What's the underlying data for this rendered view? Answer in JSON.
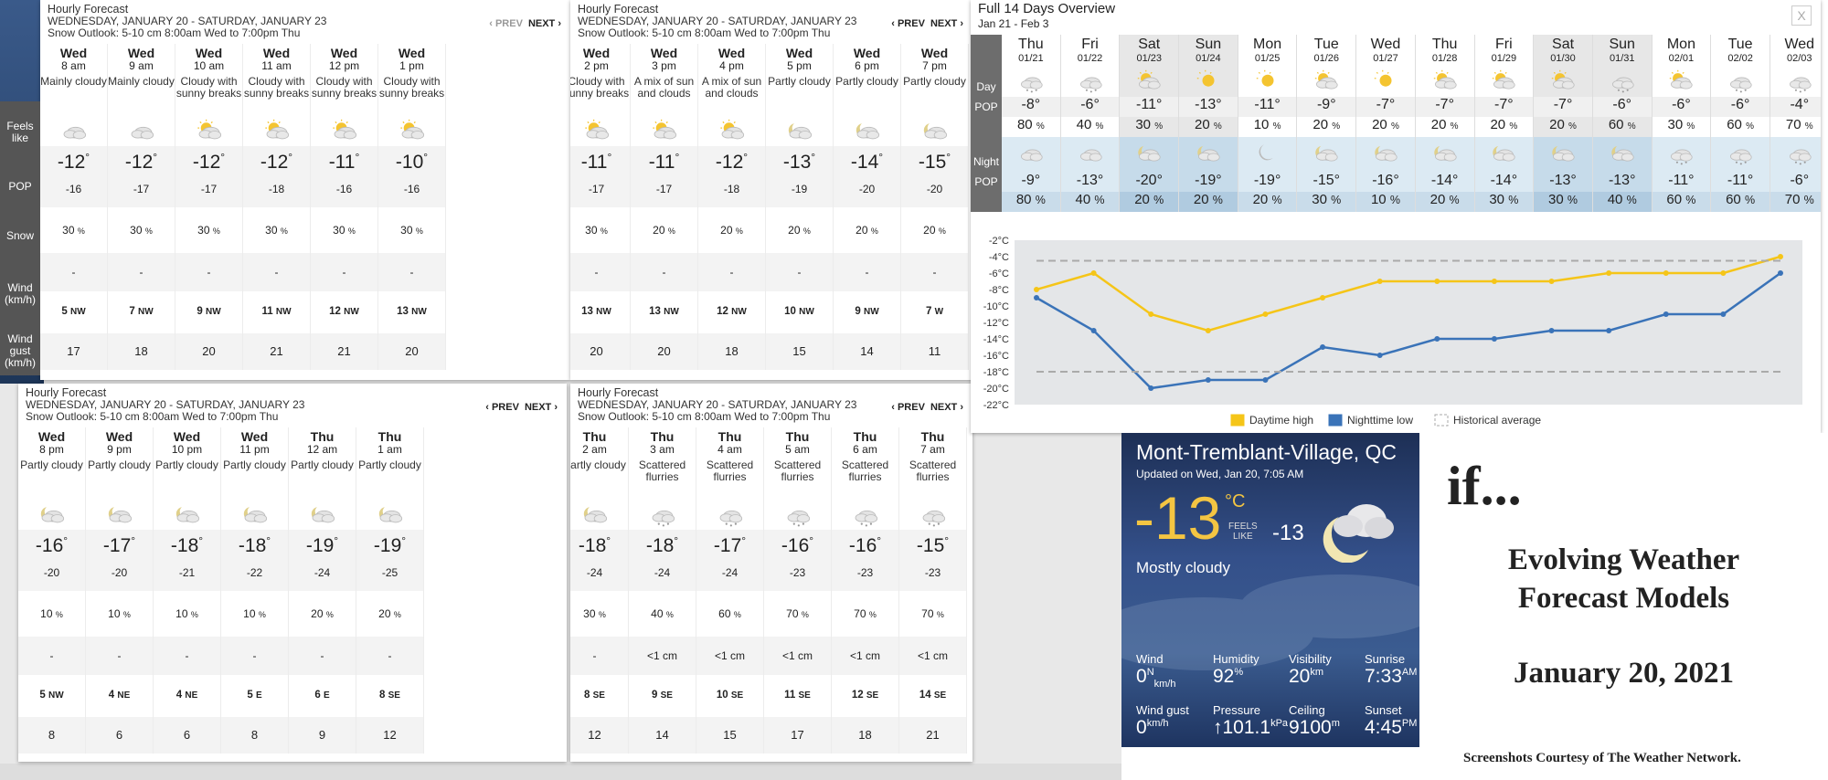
{
  "side_labels": [
    "Feels like",
    "POP",
    "Snow",
    "Wind (km/h)",
    "Wind gust (km/h)"
  ],
  "hourly_panels": [
    {
      "title": "Hourly Forecast",
      "range": "WEDNESDAY, JANUARY 20 - SATURDAY, JANUARY 23",
      "outlook": "Snow Outlook: 5-10 cm 8:00am Wed to 7:00pm Thu",
      "prev": "‹ PREV",
      "next": "NEXT ›",
      "hours": [
        {
          "day": "Wed",
          "time": "8 am",
          "cond": "Mainly cloudy",
          "icon": "mainly-cloudy-icon",
          "temp": "-12",
          "feels": "-16",
          "pop": "30",
          "snow": "-",
          "wdir": "NW",
          "wspd": "5",
          "gust": "17"
        },
        {
          "day": "Wed",
          "time": "9 am",
          "cond": "Mainly cloudy",
          "icon": "mainly-cloudy-icon",
          "temp": "-12",
          "feels": "-17",
          "pop": "30",
          "snow": "-",
          "wdir": "NW",
          "wspd": "7",
          "gust": "18"
        },
        {
          "day": "Wed",
          "time": "10 am",
          "cond": "Cloudy with sunny breaks",
          "icon": "sunny-breaks-icon",
          "temp": "-12",
          "feels": "-17",
          "pop": "30",
          "snow": "-",
          "wdir": "NW",
          "wspd": "9",
          "gust": "20"
        },
        {
          "day": "Wed",
          "time": "11 am",
          "cond": "Cloudy with sunny breaks",
          "icon": "sunny-breaks-icon",
          "temp": "-12",
          "feels": "-18",
          "pop": "30",
          "snow": "-",
          "wdir": "NW",
          "wspd": "11",
          "gust": "21"
        },
        {
          "day": "Wed",
          "time": "12 pm",
          "cond": "Cloudy with sunny breaks",
          "icon": "sunny-breaks-icon",
          "temp": "-11",
          "feels": "-16",
          "pop": "30",
          "snow": "-",
          "wdir": "NW",
          "wspd": "12",
          "gust": "21"
        },
        {
          "day": "Wed",
          "time": "1 pm",
          "cond": "Cloudy with sunny breaks",
          "icon": "sunny-breaks-icon",
          "temp": "-10",
          "feels": "-16",
          "pop": "30",
          "snow": "-",
          "wdir": "NW",
          "wspd": "13",
          "gust": "20"
        }
      ]
    },
    {
      "title": "Hourly Forecast",
      "range": "WEDNESDAY, JANUARY 20 - SATURDAY, JANUARY 23",
      "outlook": "Snow Outlook: 5-10 cm 8:00am Wed to 7:00pm Thu",
      "prev": "‹ PREV",
      "next": "NEXT ›",
      "hours": [
        {
          "day": "Wed",
          "time": "2 pm",
          "cond": "Cloudy with sunny breaks",
          "icon": "sunny-breaks-icon",
          "temp": "-11",
          "feels": "-17",
          "pop": "30",
          "snow": "-",
          "wdir": "NW",
          "wspd": "13",
          "gust": "20"
        },
        {
          "day": "Wed",
          "time": "3 pm",
          "cond": "A mix of sun and clouds",
          "icon": "sun-cloud-icon",
          "temp": "-11",
          "feels": "-17",
          "pop": "20",
          "snow": "-",
          "wdir": "NW",
          "wspd": "13",
          "gust": "20"
        },
        {
          "day": "Wed",
          "time": "4 pm",
          "cond": "A mix of sun and clouds",
          "icon": "sun-cloud-icon",
          "temp": "-12",
          "feels": "-18",
          "pop": "20",
          "snow": "-",
          "wdir": "NW",
          "wspd": "12",
          "gust": "18"
        },
        {
          "day": "Wed",
          "time": "5 pm",
          "cond": "Partly cloudy",
          "icon": "partly-cloudy-night-icon",
          "temp": "-13",
          "feels": "-19",
          "pop": "20",
          "snow": "-",
          "wdir": "NW",
          "wspd": "10",
          "gust": "15"
        },
        {
          "day": "Wed",
          "time": "6 pm",
          "cond": "Partly cloudy",
          "icon": "partly-cloudy-night-icon",
          "temp": "-14",
          "feels": "-20",
          "pop": "20",
          "snow": "-",
          "wdir": "NW",
          "wspd": "9",
          "gust": "14"
        },
        {
          "day": "Wed",
          "time": "7 pm",
          "cond": "Partly cloudy",
          "icon": "partly-cloudy-night-icon",
          "temp": "-15",
          "feels": "-20",
          "pop": "20",
          "snow": "-",
          "wdir": "W",
          "wspd": "7",
          "gust": "11"
        }
      ]
    },
    {
      "title": "Hourly Forecast",
      "range": "WEDNESDAY, JANUARY 20 - SATURDAY, JANUARY 23",
      "outlook": "Snow Outlook: 5-10 cm 8:00am Wed to 7:00pm Thu",
      "prev": "‹ PREV",
      "next": "NEXT ›",
      "hours": [
        {
          "day": "Wed",
          "time": "8 pm",
          "cond": "Partly cloudy",
          "icon": "partly-cloudy-night-icon",
          "temp": "-16",
          "feels": "-20",
          "pop": "10",
          "snow": "-",
          "wdir": "NW",
          "wspd": "5",
          "gust": "8"
        },
        {
          "day": "Wed",
          "time": "9 pm",
          "cond": "Partly cloudy",
          "icon": "partly-cloudy-night-icon",
          "temp": "-17",
          "feels": "-20",
          "pop": "10",
          "snow": "-",
          "wdir": "NE",
          "wspd": "4",
          "gust": "6"
        },
        {
          "day": "Wed",
          "time": "10 pm",
          "cond": "Partly cloudy",
          "icon": "partly-cloudy-night-icon",
          "temp": "-18",
          "feels": "-21",
          "pop": "10",
          "snow": "-",
          "wdir": "NE",
          "wspd": "4",
          "gust": "6"
        },
        {
          "day": "Wed",
          "time": "11 pm",
          "cond": "Partly cloudy",
          "icon": "partly-cloudy-night-icon",
          "temp": "-18",
          "feels": "-22",
          "pop": "10",
          "snow": "-",
          "wdir": "E",
          "wspd": "5",
          "gust": "8"
        },
        {
          "day": "Thu",
          "time": "12 am",
          "cond": "Partly cloudy",
          "icon": "partly-cloudy-night-icon",
          "temp": "-19",
          "feels": "-24",
          "pop": "20",
          "snow": "-",
          "wdir": "E",
          "wspd": "6",
          "gust": "9"
        },
        {
          "day": "Thu",
          "time": "1 am",
          "cond": "Partly cloudy",
          "icon": "partly-cloudy-night-icon",
          "temp": "-19",
          "feels": "-25",
          "pop": "20",
          "snow": "-",
          "wdir": "SE",
          "wspd": "8",
          "gust": "12"
        }
      ]
    },
    {
      "title": "Hourly Forecast",
      "range": "WEDNESDAY, JANUARY 20 - SATURDAY, JANUARY 23",
      "outlook": "Snow Outlook: 5-10 cm 8:00am Wed to 7:00pm Thu",
      "prev": "‹ PREV",
      "next": "NEXT ›",
      "hours": [
        {
          "day": "Thu",
          "time": "2 am",
          "cond": "Partly cloudy",
          "icon": "partly-cloudy-night-icon",
          "temp": "-18",
          "feels": "-24",
          "pop": "30",
          "snow": "-",
          "wdir": "SE",
          "wspd": "8",
          "gust": "12"
        },
        {
          "day": "Thu",
          "time": "3 am",
          "cond": "Scattered flurries",
          "icon": "flurries-icon",
          "temp": "-18",
          "feels": "-24",
          "pop": "40",
          "snow": "<1 cm",
          "wdir": "SE",
          "wspd": "9",
          "gust": "14"
        },
        {
          "day": "Thu",
          "time": "4 am",
          "cond": "Scattered flurries",
          "icon": "flurries-icon",
          "temp": "-17",
          "feels": "-24",
          "pop": "60",
          "snow": "<1 cm",
          "wdir": "SE",
          "wspd": "10",
          "gust": "15"
        },
        {
          "day": "Thu",
          "time": "5 am",
          "cond": "Scattered flurries",
          "icon": "flurries-icon",
          "temp": "-16",
          "feels": "-23",
          "pop": "70",
          "snow": "<1 cm",
          "wdir": "SE",
          "wspd": "11",
          "gust": "17"
        },
        {
          "day": "Thu",
          "time": "6 am",
          "cond": "Scattered flurries",
          "icon": "flurries-icon",
          "temp": "-16",
          "feels": "-23",
          "pop": "70",
          "snow": "<1 cm",
          "wdir": "SE",
          "wspd": "12",
          "gust": "18"
        },
        {
          "day": "Thu",
          "time": "7 am",
          "cond": "Scattered flurries",
          "icon": "flurries-icon",
          "temp": "-15",
          "feels": "-23",
          "pop": "70",
          "snow": "<1 cm",
          "wdir": "SE",
          "wspd": "14",
          "gust": "21"
        }
      ]
    }
  ],
  "overview": {
    "title": "Full 14 Days Overview",
    "range": "Jan 21 - Feb 3",
    "close": "X",
    "day_label": "Day",
    "pop_label": "POP",
    "night_label": "Night",
    "days": [
      {
        "day": "Thu",
        "date": "01/21",
        "hi": "-8",
        "dpop": "80",
        "lo": "-9",
        "npop": "80",
        "we": false
      },
      {
        "day": "Fri",
        "date": "01/22",
        "hi": "-6",
        "dpop": "40",
        "lo": "-13",
        "npop": "40",
        "we": false
      },
      {
        "day": "Sat",
        "date": "01/23",
        "hi": "-11",
        "dpop": "30",
        "lo": "-20",
        "npop": "20",
        "we": true
      },
      {
        "day": "Sun",
        "date": "01/24",
        "hi": "-13",
        "dpop": "20",
        "lo": "-19",
        "npop": "20",
        "we": true
      },
      {
        "day": "Mon",
        "date": "01/25",
        "hi": "-11",
        "dpop": "10",
        "lo": "-19",
        "npop": "20",
        "we": false
      },
      {
        "day": "Tue",
        "date": "01/26",
        "hi": "-9",
        "dpop": "20",
        "lo": "-15",
        "npop": "30",
        "we": false
      },
      {
        "day": "Wed",
        "date": "01/27",
        "hi": "-7",
        "dpop": "20",
        "lo": "-16",
        "npop": "10",
        "we": false
      },
      {
        "day": "Thu",
        "date": "01/28",
        "hi": "-7",
        "dpop": "20",
        "lo": "-14",
        "npop": "20",
        "we": false
      },
      {
        "day": "Fri",
        "date": "01/29",
        "hi": "-7",
        "dpop": "20",
        "lo": "-14",
        "npop": "30",
        "we": false
      },
      {
        "day": "Sat",
        "date": "01/30",
        "hi": "-7",
        "dpop": "20",
        "lo": "-13",
        "npop": "30",
        "we": true
      },
      {
        "day": "Sun",
        "date": "01/31",
        "hi": "-6",
        "dpop": "60",
        "lo": "-13",
        "npop": "40",
        "we": true
      },
      {
        "day": "Mon",
        "date": "02/01",
        "hi": "-6",
        "dpop": "30",
        "lo": "-11",
        "npop": "60",
        "we": false
      },
      {
        "day": "Tue",
        "date": "02/02",
        "hi": "-6",
        "dpop": "60",
        "lo": "-11",
        "npop": "60",
        "we": false
      },
      {
        "day": "Wed",
        "date": "02/03",
        "hi": "-4",
        "dpop": "70",
        "lo": "-6",
        "npop": "70",
        "we": false
      }
    ]
  },
  "chart_data": {
    "type": "line",
    "x": [
      "01/21",
      "01/22",
      "01/23",
      "01/24",
      "01/25",
      "01/26",
      "01/27",
      "01/28",
      "01/29",
      "01/30",
      "01/31",
      "02/01",
      "02/02",
      "02/03"
    ],
    "series": [
      {
        "name": "Daytime high",
        "color": "#f5c518",
        "values": [
          -8,
          -6,
          -11,
          -13,
          -11,
          -9,
          -7,
          -7,
          -7,
          -7,
          -6,
          -6,
          -6,
          -4
        ]
      },
      {
        "name": "Nighttime low",
        "color": "#3a73b8",
        "values": [
          -9,
          -13,
          -20,
          -19,
          -19,
          -15,
          -16,
          -14,
          -14,
          -13,
          -13,
          -11,
          -11,
          -6
        ]
      },
      {
        "name": "Historical average",
        "color": "#aaaaaa",
        "values": [
          -4.5,
          -4.5,
          -4.5,
          -4.5,
          -4.5,
          -4.5,
          -4.5,
          -4.5,
          -4.5,
          -4.5,
          -4.5,
          -4.5,
          -4.5,
          -4.5
        ]
      },
      {
        "name": "",
        "color": "#aaaaaa",
        "values": [
          -18,
          -18,
          -18,
          -18,
          -18,
          -18,
          -18,
          -18,
          -18,
          -18,
          -18,
          -18,
          -18,
          -18
        ]
      }
    ],
    "yticks": [
      "-2°C",
      "-4°C",
      "-6°C",
      "-8°C",
      "-10°C",
      "-12°C",
      "-14°C",
      "-16°C",
      "-18°C",
      "-20°C",
      "-22°C"
    ],
    "ylim": [
      -22,
      -2
    ],
    "legend_position": "bottom"
  },
  "current": {
    "location": "Mont-Tremblant-Village, QC",
    "updated": "Updated on Wed, Jan 20, 7:05 AM",
    "temp": "-13",
    "unit": "°C",
    "feels_label1": "FEELS",
    "feels_label2": "LIKE",
    "feels": "-13",
    "condition": "Mostly cloudy",
    "wind_label": "Wind",
    "wind": "0",
    "wind_dir": "N",
    "wind_unit": "km/h",
    "humidity_label": "Humidity",
    "humidity": "92",
    "humidity_unit": "%",
    "visibility_label": "Visibility",
    "visibility": "20",
    "visibility_unit": "km",
    "sunrise_label": "Sunrise",
    "sunrise": "7:33",
    "sunrise_ampm": "AM",
    "gust_label": "Wind gust",
    "gust": "0",
    "gust_unit": "km/h",
    "pressure_label": "Pressure",
    "pressure": "↑101.1",
    "pressure_unit": "kPa",
    "ceiling_label": "Ceiling",
    "ceiling": "9100",
    "ceiling_unit": "m",
    "sunset_label": "Sunset",
    "sunset": "4:45",
    "sunset_ampm": "PM"
  },
  "slide": {
    "if": "if...",
    "title1": "Evolving Weather",
    "title2": "Forecast Models",
    "date": "January 20, 2021",
    "credit": "Screenshots Courtesy of The Weather Network."
  }
}
